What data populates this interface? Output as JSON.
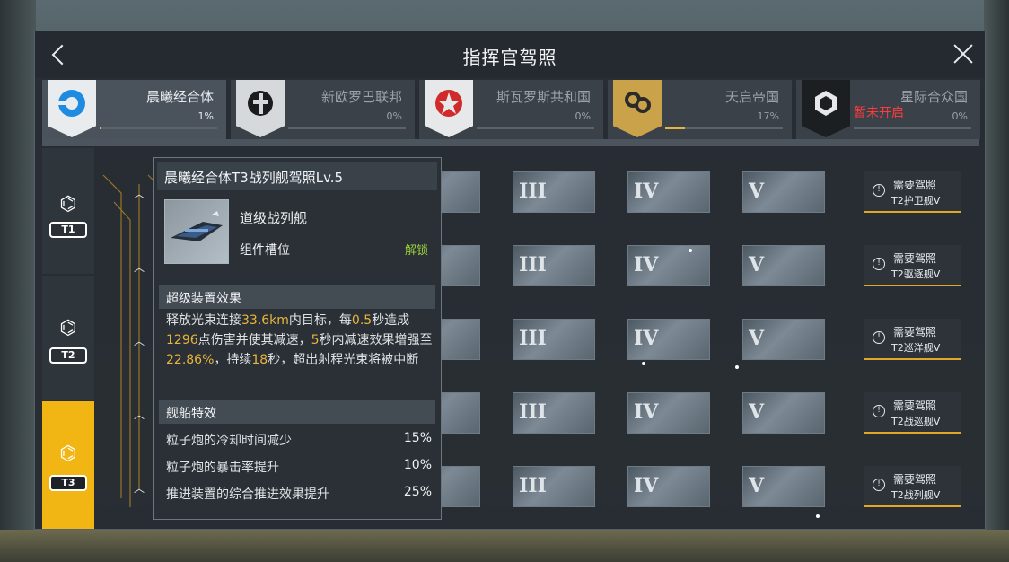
{
  "title": "指挥官驾照",
  "factions": [
    {
      "name": "晨曦经合体",
      "percent": "1%",
      "progress": 0.01,
      "emblem_color": "#e9ecef",
      "active": true
    },
    {
      "name": "新欧罗巴联邦",
      "percent": "0%",
      "progress": 0,
      "emblem_color": "#d6d9dc",
      "active": false
    },
    {
      "name": "斯瓦罗斯共和国",
      "percent": "0%",
      "progress": 0,
      "emblem_color": "#e6e8ea",
      "active": false
    },
    {
      "name": "天启帝国",
      "percent": "17%",
      "progress": 0.17,
      "emblem_color": "#c9a24a",
      "active": false
    },
    {
      "name": "星际合众国",
      "percent": "0%",
      "progress": 0,
      "emblem_color": "#1c1f22",
      "active": false,
      "status": "暂未开启"
    }
  ],
  "tiers": [
    {
      "label": "T1",
      "icon": "molecule-icon"
    },
    {
      "label": "T2",
      "icon": "molecule-icon"
    },
    {
      "label": "T3",
      "icon": "molecule-icon",
      "active": true
    }
  ],
  "grid_levels": [
    "III",
    "IV",
    "V"
  ],
  "requirements": [
    {
      "line1": "需要驾照",
      "line2": "T2护卫舰V"
    },
    {
      "line1": "需要驾照",
      "line2": "T2驱逐舰V"
    },
    {
      "line1": "需要驾照",
      "line2": "T2巡洋舰V"
    },
    {
      "line1": "需要驾照",
      "line2": "T2战巡舰V"
    },
    {
      "line1": "需要驾照",
      "line2": "T2战列舰V"
    }
  ],
  "popup": {
    "title": "晨曦经合体T3战列舰驾照Lv.5",
    "ship_name": "道级战列舰",
    "slot_label": "组件槽位",
    "unlock_label": "解锁",
    "super_section": "超级装置效果",
    "desc_parts": [
      "释放光束连接",
      "33.6km",
      "内目标，每",
      "0.5",
      "秒造成",
      "1296",
      "点伤害并使其减速，",
      "5",
      "秒内减速效果增强至",
      "22.86%",
      "，持续",
      "18",
      "秒，超出射程光束将被中断"
    ],
    "ship_section": "舰船特效",
    "effects": [
      {
        "label": "粒子炮的冷却时间减少",
        "value": "15%"
      },
      {
        "label": "粒子炮的暴击率提升",
        "value": "10%"
      },
      {
        "label": "推进装置的综合推进效果提升",
        "value": "25%"
      }
    ]
  }
}
